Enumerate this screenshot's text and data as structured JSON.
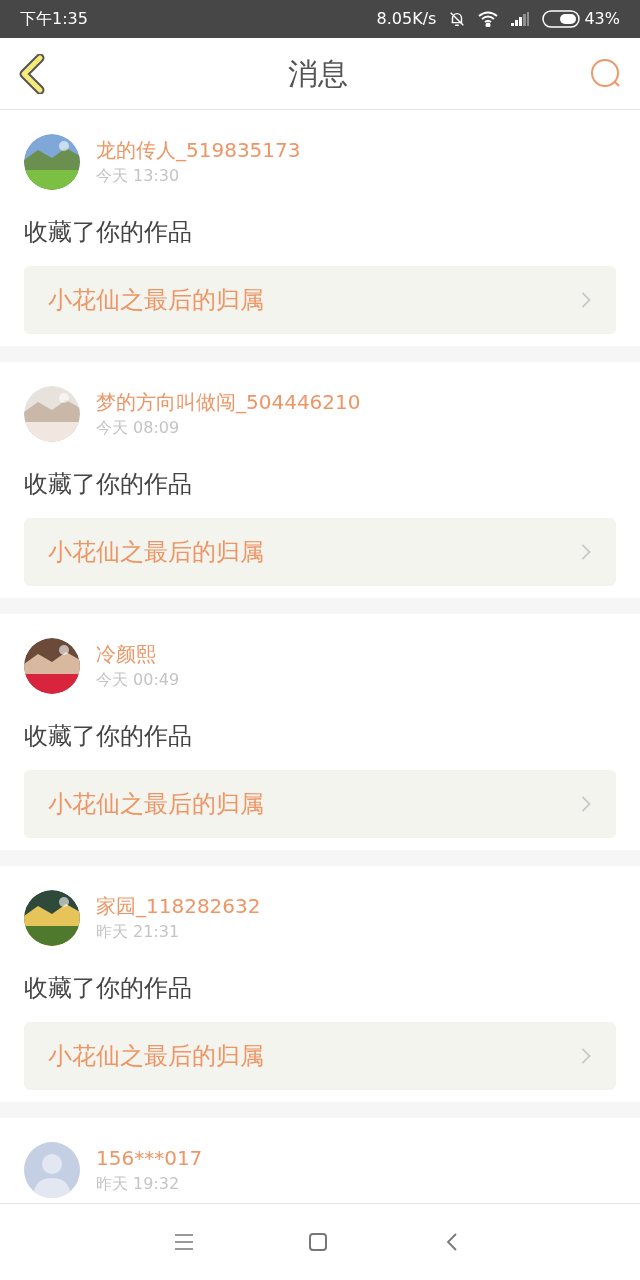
{
  "status_bar": {
    "time": "下午1:35",
    "speed": "8.05K/s",
    "battery": "43%"
  },
  "header": {
    "title": "消息"
  },
  "messages": [
    {
      "name": "龙的传人_519835173",
      "time": "今天 13:30",
      "action": "收藏了你的作品",
      "work": "小花仙之最后的归属"
    },
    {
      "name": "梦的方向叫做闯_504446210",
      "time": "今天 08:09",
      "action": "收藏了你的作品",
      "work": "小花仙之最后的归属"
    },
    {
      "name": "冷颜熙",
      "time": "今天 00:49",
      "action": "收藏了你的作品",
      "work": "小花仙之最后的归属"
    },
    {
      "name": "家园_118282632",
      "time": "昨天 21:31",
      "action": "收藏了你的作品",
      "work": "小花仙之最后的归属"
    },
    {
      "avatar": {
        "kind": "default"
      },
      "name": "156***017",
      "time": "昨天 19:32"
    }
  ]
}
